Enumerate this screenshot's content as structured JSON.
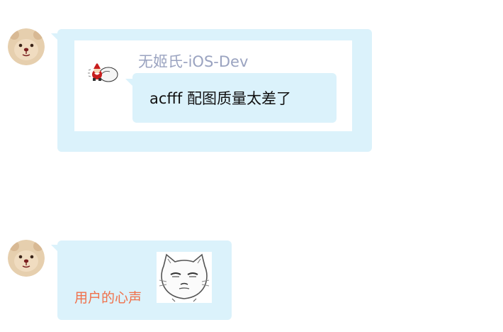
{
  "messages": [
    {
      "type": "quote",
      "quoted": {
        "author": "无姬氏-iOS-Dev",
        "text": "acfff 配图质量太差了",
        "avatar_icon": "santa-sticker-icon"
      },
      "avatar_icon": "bear-avatar-icon"
    },
    {
      "type": "text-with-sticker",
      "text": "用户的心声",
      "sticker_icon": "grumpy-cat-sticker-icon",
      "avatar_icon": "bear-avatar-icon"
    }
  ],
  "colors": {
    "bubble": "#dbf2fb",
    "author": "#9aa3c0",
    "accent_text": "#f0704a"
  }
}
